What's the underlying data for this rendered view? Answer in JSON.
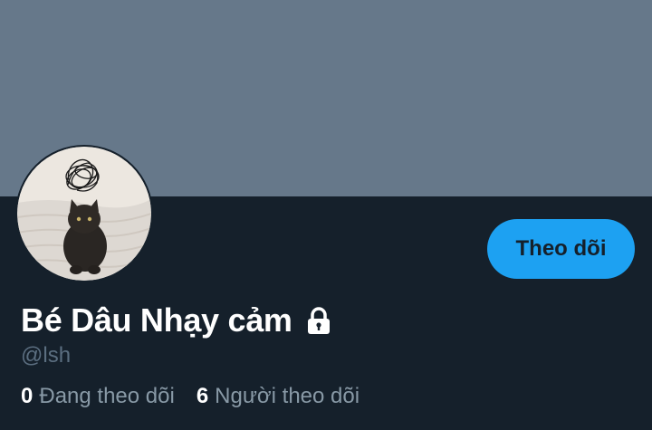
{
  "profile": {
    "display_name": "Bé Dâu Nhạy cảm",
    "handle": "@lsh",
    "follow_button_label": "Theo dõi",
    "protected_icon": "lock-icon",
    "avatar_image": "black kitten avatar with scribble"
  },
  "stats": {
    "following_count": "0",
    "following_label": "Đang theo dõi",
    "followers_count": "6",
    "followers_label": "Người theo dõi"
  },
  "colors": {
    "background": "#15202b",
    "banner": "#66788a",
    "accent": "#1da1f2",
    "secondary_text": "#8899a6",
    "handle_text": "#5b6e80"
  }
}
